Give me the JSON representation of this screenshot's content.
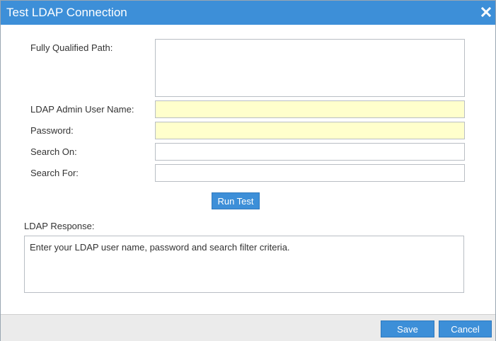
{
  "dialog": {
    "title": "Test LDAP Connection",
    "close_icon": "close-icon"
  },
  "form": {
    "fully_qualified_path": {
      "label": "Fully Qualified Path:",
      "value": ""
    },
    "admin_user_name": {
      "label": "LDAP Admin User Name:",
      "value": ""
    },
    "password": {
      "label": "Password:",
      "value": ""
    },
    "search_on": {
      "label": "Search On:",
      "value": ""
    },
    "search_for": {
      "label": "Search For:",
      "value": ""
    },
    "run_test_label": "Run Test"
  },
  "response": {
    "label": "LDAP Response:",
    "text": "Enter your LDAP user name, password and search filter criteria."
  },
  "footer": {
    "save_label": "Save",
    "cancel_label": "Cancel"
  },
  "colors": {
    "accent": "#3d8fd8",
    "required_field": "#ffffcc",
    "footer_bg": "#ebebeb"
  }
}
